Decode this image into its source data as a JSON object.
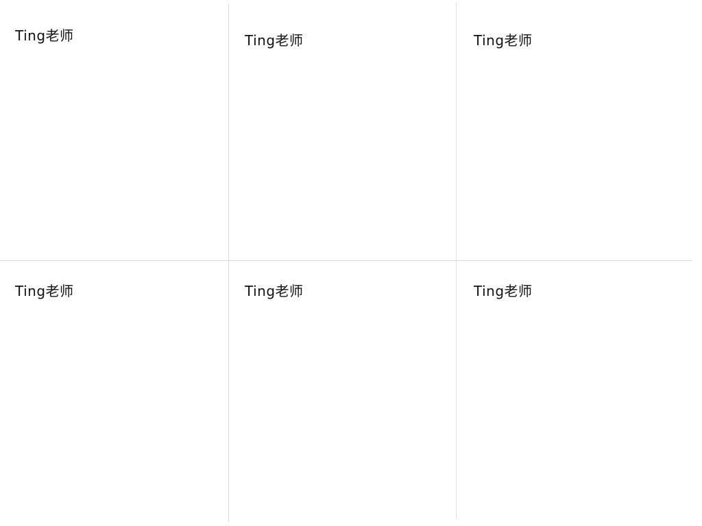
{
  "cells": [
    {
      "label": "Ting老师"
    },
    {
      "label": "Ting老师"
    },
    {
      "label": "Ting老师"
    },
    {
      "label": "Ting老师"
    },
    {
      "label": "Ting老师"
    },
    {
      "label": "Ting老师"
    }
  ],
  "colors": {
    "background": "#ffffff",
    "divider": "#dcdcdc",
    "text": "#111111"
  }
}
